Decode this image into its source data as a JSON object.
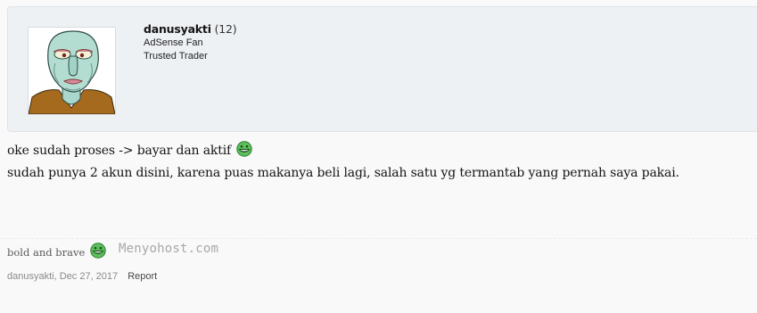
{
  "user": {
    "name": "danusyakti",
    "post_count": "(12)",
    "titles": [
      "AdSense Fan",
      "Trusted Trader"
    ],
    "avatar_icon": "handsome-squidward-avatar"
  },
  "message": {
    "lines": [
      "oke sudah proses -> bayar dan aktif",
      "sudah punya 2 akun disini, karena puas makanya beli lagi, salah satu yg termantab yang pernah saya pakai."
    ],
    "smiley_icon": "grin-smiley-icon"
  },
  "signature": {
    "text": "bold and brave"
  },
  "watermark": "Menyohost.com",
  "meta": {
    "author": "danusyakti",
    "separator": ",",
    "date": "Dec 27, 2017",
    "report_label": "Report"
  },
  "colors": {
    "panel_bg": "#eef1f4",
    "page_bg": "#f9f9f9",
    "smiley_green": "#4caf50"
  }
}
